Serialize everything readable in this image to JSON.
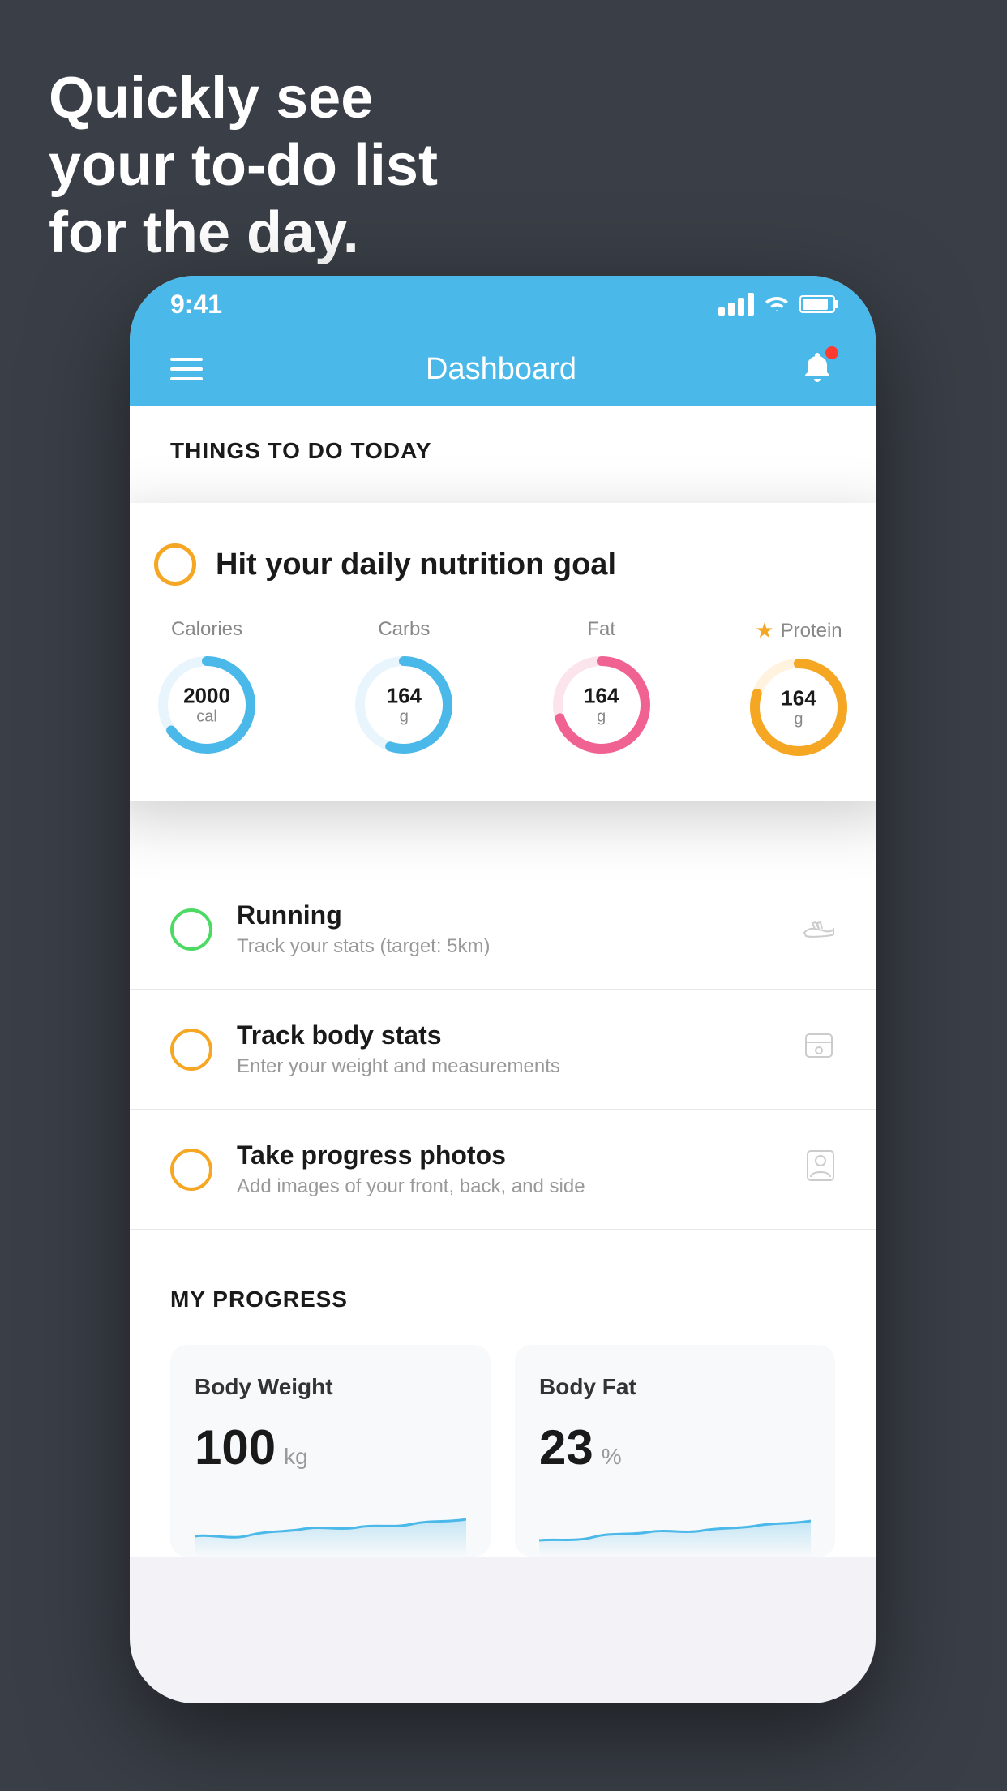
{
  "background": {
    "color": "#3a3f47"
  },
  "headline": {
    "line1": "Quickly see",
    "line2": "your to-do list",
    "line3": "for the day."
  },
  "phone": {
    "status_bar": {
      "time": "9:41"
    },
    "nav": {
      "title": "Dashboard"
    },
    "things_header": "THINGS TO DO TODAY",
    "floating_card": {
      "title": "Hit your daily nutrition goal",
      "nutrition": [
        {
          "label": "Calories",
          "value": "2000",
          "unit": "cal",
          "color": "#4ab8e8",
          "track_color": "#e8f5fd",
          "progress": 0.65
        },
        {
          "label": "Carbs",
          "value": "164",
          "unit": "g",
          "color": "#4ab8e8",
          "track_color": "#e8f5fd",
          "progress": 0.55
        },
        {
          "label": "Fat",
          "value": "164",
          "unit": "g",
          "color": "#f06292",
          "track_color": "#fce4ec",
          "progress": 0.7
        },
        {
          "label": "Protein",
          "value": "164",
          "unit": "g",
          "color": "#f5a623",
          "track_color": "#fff3e0",
          "progress": 0.8,
          "starred": true
        }
      ]
    },
    "todo_items": [
      {
        "title": "Running",
        "subtitle": "Track your stats (target: 5km)",
        "circle_color": "green",
        "icon": "shoe"
      },
      {
        "title": "Track body stats",
        "subtitle": "Enter your weight and measurements",
        "circle_color": "yellow",
        "icon": "scale"
      },
      {
        "title": "Take progress photos",
        "subtitle": "Add images of your front, back, and side",
        "circle_color": "yellow",
        "icon": "person"
      }
    ],
    "progress": {
      "header": "MY PROGRESS",
      "cards": [
        {
          "title": "Body Weight",
          "value": "100",
          "unit": "kg"
        },
        {
          "title": "Body Fat",
          "value": "23",
          "unit": "%"
        }
      ]
    }
  }
}
